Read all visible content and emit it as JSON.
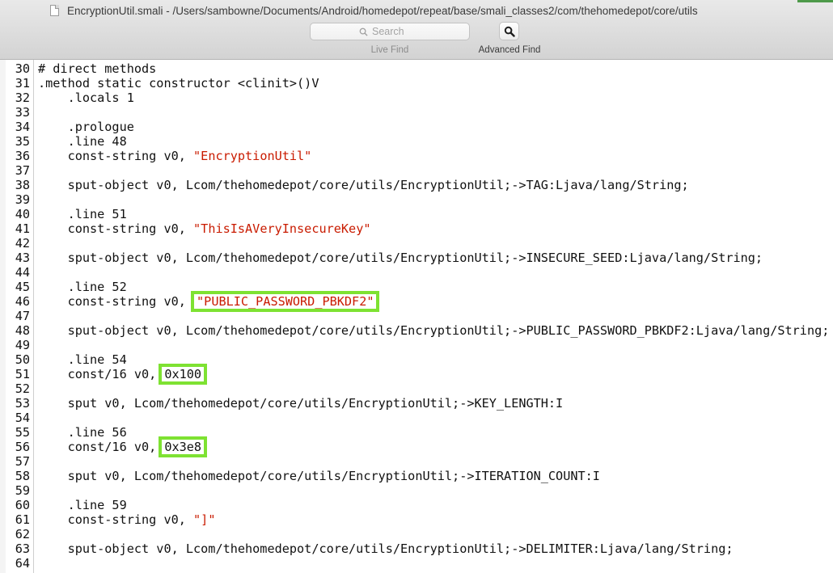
{
  "window": {
    "title": "EncryptionUtil.smali - /Users/sambowne/Documents/Android/homedepot/repeat/base/smali_classes2/com/thehomedepot/core/utils"
  },
  "toolbar": {
    "search_placeholder": "Search",
    "live_find_label": "Live Find",
    "advanced_find_label": "Advanced Find"
  },
  "colors": {
    "string_literal": "#c91b00",
    "highlight_box": "#7ee232"
  },
  "editor": {
    "lines": [
      {
        "n": "30",
        "parts": [
          {
            "t": "# direct methods"
          }
        ]
      },
      {
        "n": "31",
        "parts": [
          {
            "t": ".method static constructor <clinit>()V"
          }
        ]
      },
      {
        "n": "32",
        "parts": [
          {
            "t": "    .locals 1"
          }
        ]
      },
      {
        "n": "33",
        "parts": []
      },
      {
        "n": "34",
        "parts": [
          {
            "t": "    .prologue"
          }
        ]
      },
      {
        "n": "35",
        "parts": [
          {
            "t": "    .line 48"
          }
        ]
      },
      {
        "n": "36",
        "parts": [
          {
            "t": "    const-string v0, "
          },
          {
            "t": "\"EncryptionUtil\"",
            "s": true
          }
        ]
      },
      {
        "n": "37",
        "parts": []
      },
      {
        "n": "38",
        "parts": [
          {
            "t": "    sput-object v0, Lcom/thehomedepot/core/utils/EncryptionUtil;->TAG:Ljava/lang/String;"
          }
        ]
      },
      {
        "n": "39",
        "parts": []
      },
      {
        "n": "40",
        "parts": [
          {
            "t": "    .line 51"
          }
        ]
      },
      {
        "n": "41",
        "parts": [
          {
            "t": "    const-string v0, "
          },
          {
            "t": "\"ThisIsAVeryInsecureKey\"",
            "s": true
          }
        ]
      },
      {
        "n": "42",
        "parts": []
      },
      {
        "n": "43",
        "parts": [
          {
            "t": "    sput-object v0, Lcom/thehomedepot/core/utils/EncryptionUtil;->INSECURE_SEED:Ljava/lang/String;"
          }
        ]
      },
      {
        "n": "44",
        "parts": []
      },
      {
        "n": "45",
        "parts": [
          {
            "t": "    .line 52"
          }
        ]
      },
      {
        "n": "46",
        "parts": [
          {
            "t": "    const-string v0, "
          },
          {
            "t": "\"PUBLIC_PASSWORD_PBKDF2\"",
            "s": true,
            "h": true
          }
        ]
      },
      {
        "n": "47",
        "parts": []
      },
      {
        "n": "48",
        "parts": [
          {
            "t": "    sput-object v0, Lcom/thehomedepot/core/utils/EncryptionUtil;->PUBLIC_PASSWORD_PBKDF2:Ljava/lang/String;"
          }
        ]
      },
      {
        "n": "49",
        "parts": []
      },
      {
        "n": "50",
        "parts": [
          {
            "t": "    .line 54"
          }
        ]
      },
      {
        "n": "51",
        "parts": [
          {
            "t": "    const/16 v0,"
          },
          {
            "t": "0x100",
            "h": true,
            "num": true
          }
        ]
      },
      {
        "n": "52",
        "parts": []
      },
      {
        "n": "53",
        "parts": [
          {
            "t": "    sput v0, Lcom/thehomedepot/core/utils/EncryptionUtil;->KEY_LENGTH:I"
          }
        ]
      },
      {
        "n": "54",
        "parts": []
      },
      {
        "n": "55",
        "parts": [
          {
            "t": "    .line 56"
          }
        ]
      },
      {
        "n": "56",
        "parts": [
          {
            "t": "    const/16 v0,"
          },
          {
            "t": "0x3e8",
            "h": true,
            "num": true
          }
        ]
      },
      {
        "n": "57",
        "parts": []
      },
      {
        "n": "58",
        "parts": [
          {
            "t": "    sput v0, Lcom/thehomedepot/core/utils/EncryptionUtil;->ITERATION_COUNT:I"
          }
        ]
      },
      {
        "n": "59",
        "parts": []
      },
      {
        "n": "60",
        "parts": [
          {
            "t": "    .line 59"
          }
        ]
      },
      {
        "n": "61",
        "parts": [
          {
            "t": "    const-string v0, "
          },
          {
            "t": "\"]\"",
            "s": true
          }
        ]
      },
      {
        "n": "62",
        "parts": []
      },
      {
        "n": "63",
        "parts": [
          {
            "t": "    sput-object v0, Lcom/thehomedepot/core/utils/EncryptionUtil;->DELIMITER:Ljava/lang/String;"
          }
        ]
      },
      {
        "n": "64",
        "parts": []
      }
    ]
  }
}
